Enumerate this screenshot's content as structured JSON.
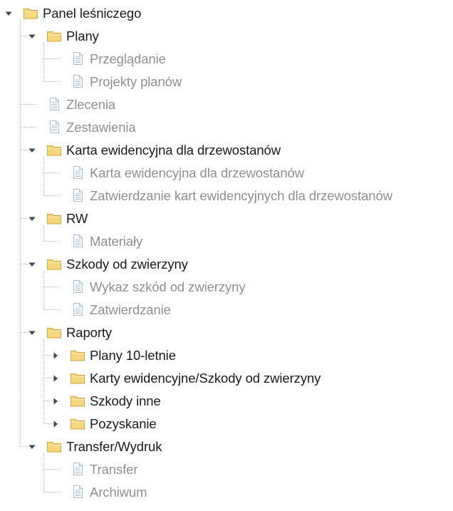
{
  "colors": {
    "folder_text": "#1a1a1a",
    "leaf_text": "#8f8f8f",
    "folder_fill": "#f4d77e",
    "folder_edge": "#d1a635",
    "leaf_icon": "#a9bfdd",
    "tree_line": "#b9b9b9"
  },
  "icons": {
    "folder": "folder-icon",
    "leaf": "document-icon",
    "expanded": "triangle-down-icon",
    "collapsed": "triangle-right-icon"
  },
  "tree": [
    {
      "label": "Panel leśniczego",
      "expanded": true,
      "children": [
        {
          "label": "Plany",
          "expanded": true,
          "children": [
            {
              "label": "Przeglądanie"
            },
            {
              "label": "Projekty planów"
            }
          ]
        },
        {
          "label": "Zlecenia"
        },
        {
          "label": "Zestawienia"
        },
        {
          "label": "Karta ewidencyjna dla drzewostanów",
          "expanded": true,
          "children": [
            {
              "label": "Karta ewidencyjna dla drzewostanów"
            },
            {
              "label": "Zatwierdzanie kart ewidencyjnych dla drzewostanów"
            }
          ]
        },
        {
          "label": "RW",
          "expanded": true,
          "children": [
            {
              "label": "Materiały"
            }
          ]
        },
        {
          "label": "Szkody od zwierzyny",
          "expanded": true,
          "children": [
            {
              "label": "Wykaz szkód od zwierzyny"
            },
            {
              "label": "Zatwierdzanie"
            }
          ]
        },
        {
          "label": "Raporty",
          "expanded": true,
          "children": [
            {
              "label": "Plany 10-letnie",
              "expanded": false,
              "children": []
            },
            {
              "label": "Karty ewidencyjne/Szkody od zwierzyny",
              "expanded": false,
              "children": []
            },
            {
              "label": "Szkody inne",
              "expanded": false,
              "children": []
            },
            {
              "label": "Pozyskanie",
              "expanded": false,
              "children": []
            }
          ]
        },
        {
          "label": "Transfer/Wydruk",
          "expanded": true,
          "children": [
            {
              "label": "Transfer"
            },
            {
              "label": "Archiwum"
            }
          ]
        }
      ]
    }
  ]
}
